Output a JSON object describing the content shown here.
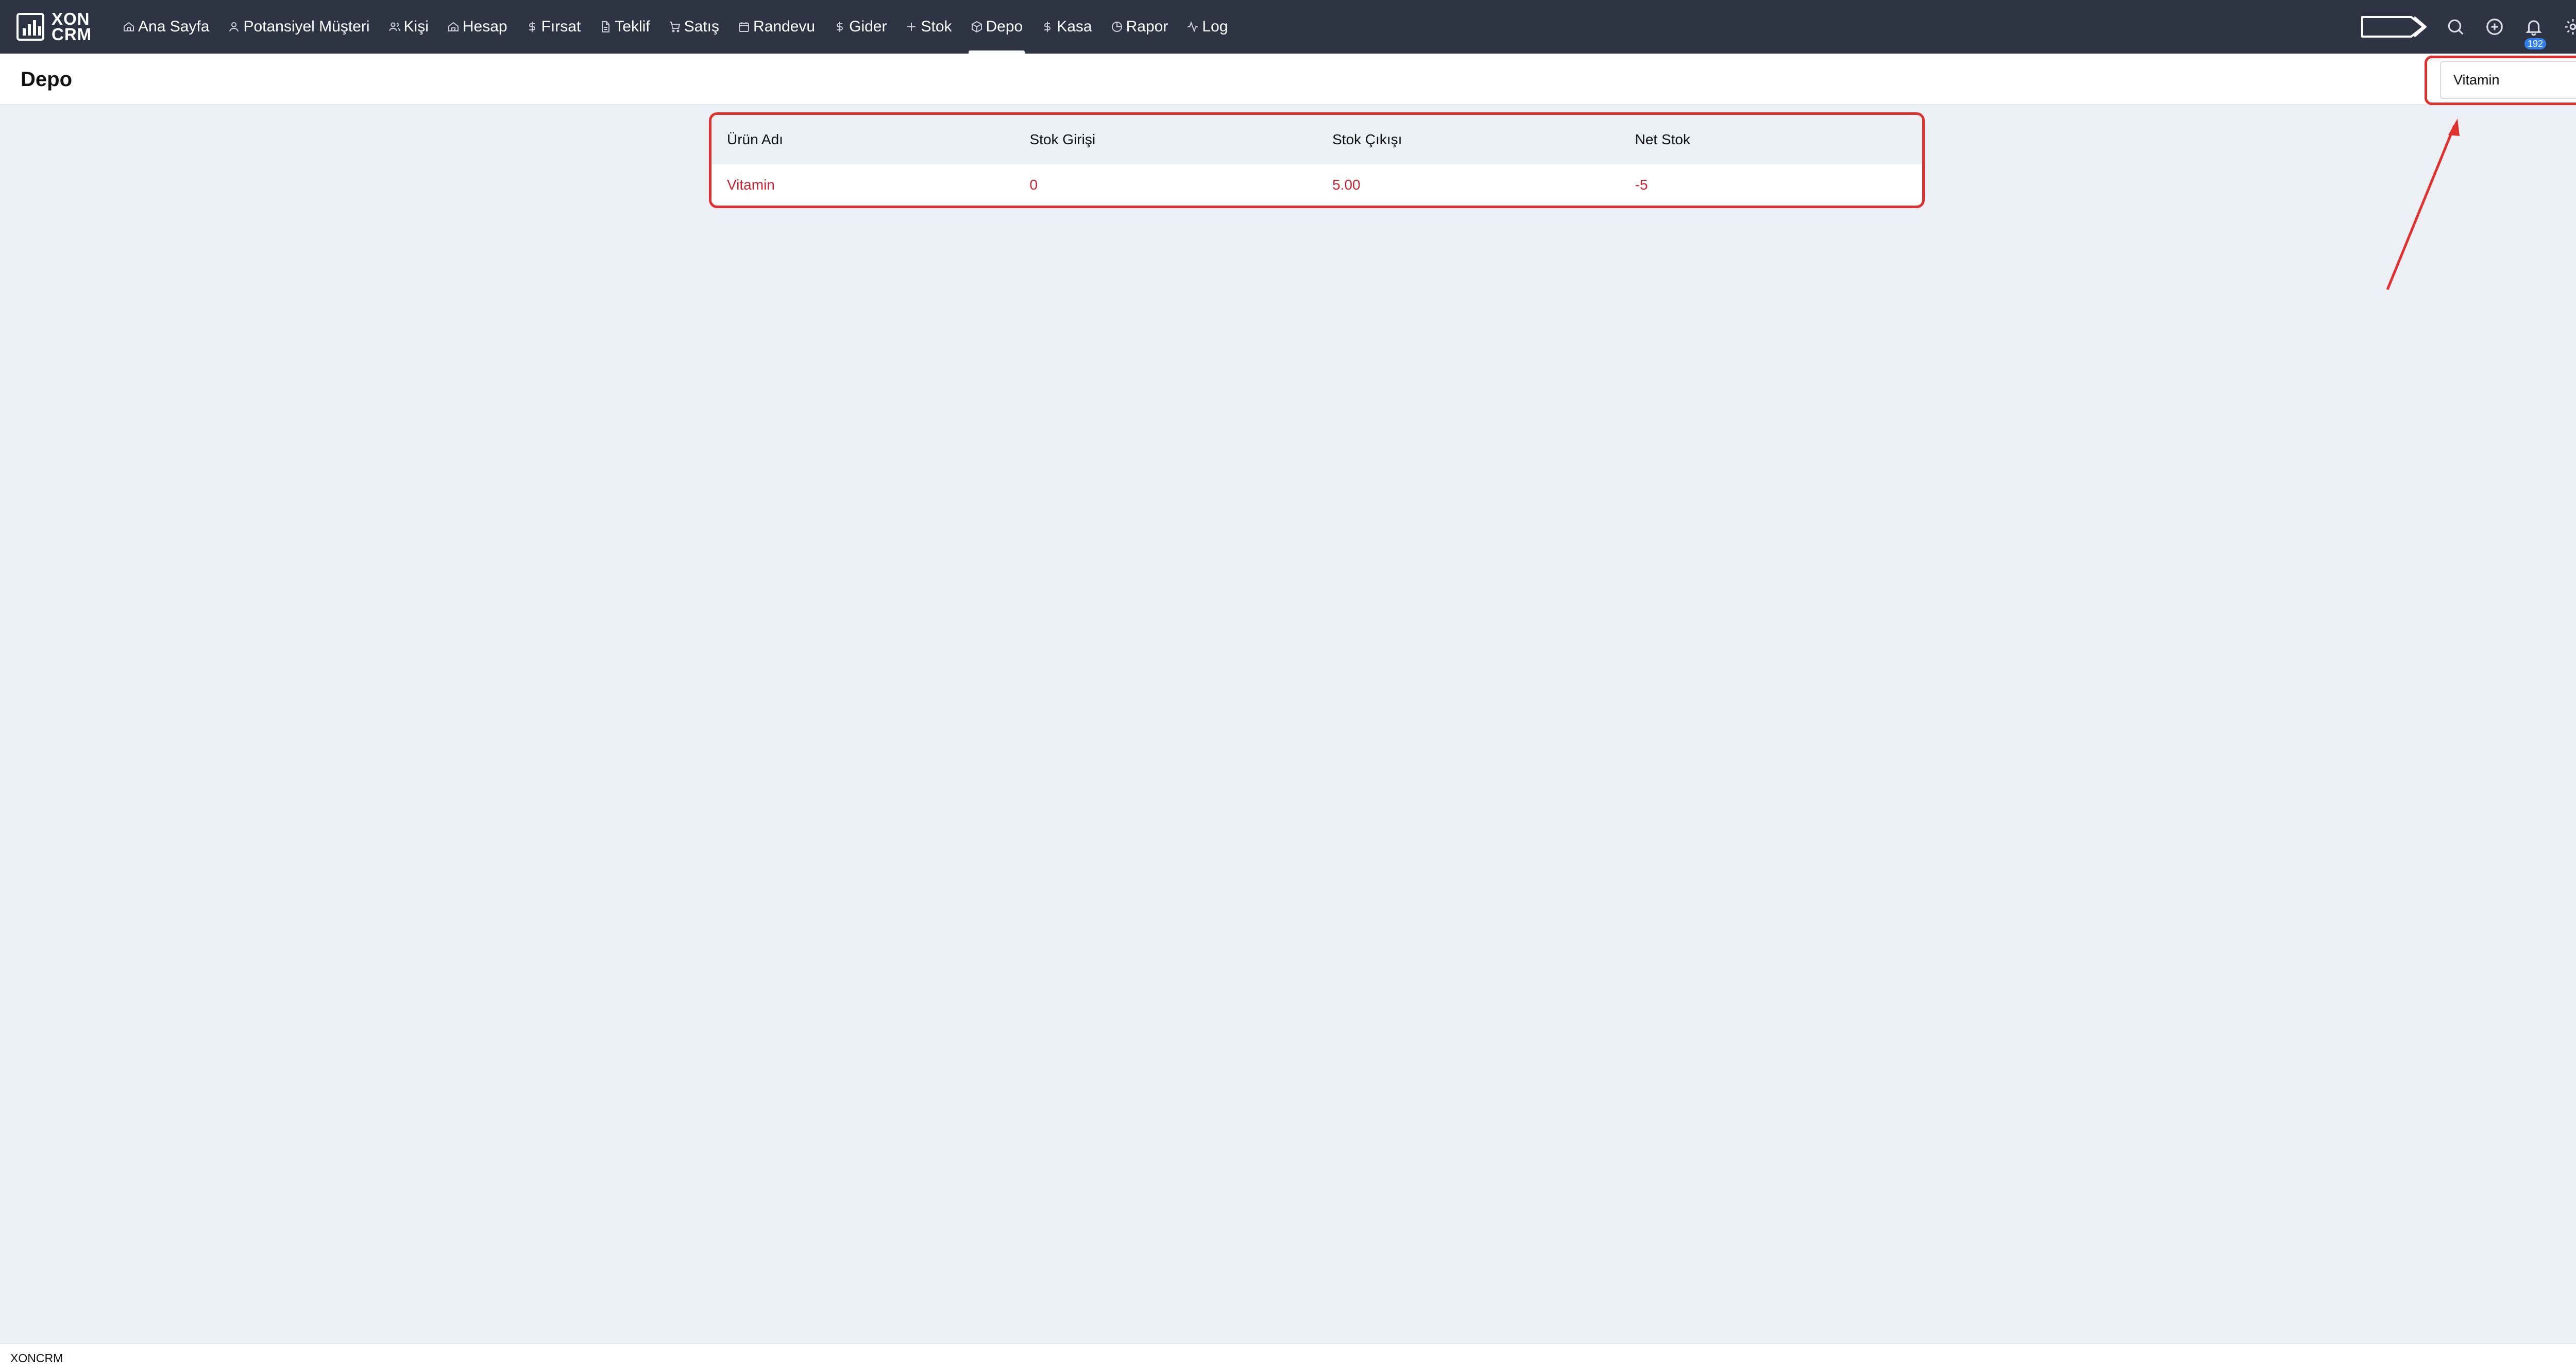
{
  "app": {
    "logo_line1": "XON",
    "logo_line2": "CRM"
  },
  "nav": {
    "items": [
      {
        "label": "Ana Sayfa",
        "icon": "home-icon"
      },
      {
        "label": "Potansiyel Müşteri",
        "icon": "user-icon"
      },
      {
        "label": "Kişi",
        "icon": "users-icon"
      },
      {
        "label": "Hesap",
        "icon": "home-icon"
      },
      {
        "label": "Fırsat",
        "icon": "dollar-icon"
      },
      {
        "label": "Teklif",
        "icon": "document-icon"
      },
      {
        "label": "Satış",
        "icon": "cart-icon"
      },
      {
        "label": "Randevu",
        "icon": "calendar-icon"
      },
      {
        "label": "Gider",
        "icon": "dollar-icon"
      },
      {
        "label": "Stok",
        "icon": "plus-icon"
      },
      {
        "label": "Depo",
        "icon": "box-icon",
        "active": true
      },
      {
        "label": "Kasa",
        "icon": "dollar-icon"
      },
      {
        "label": "Rapor",
        "icon": "pie-chart-icon"
      },
      {
        "label": "Log",
        "icon": "activity-icon"
      }
    ]
  },
  "tools": {
    "notification_count": "192"
  },
  "page": {
    "title": "Depo",
    "search_value": "Vitamin"
  },
  "table": {
    "columns": [
      "Ürün Adı",
      "Stok Girişi",
      "Stok Çıkışı",
      "Net Stok"
    ],
    "rows": [
      [
        "Vitamin",
        "0",
        "5.00",
        "-5"
      ]
    ]
  },
  "footer": {
    "text": "XONCRM"
  },
  "colors": {
    "topbar": "#2e3443",
    "highlight": "#e0312f",
    "row_text": "#cc2233",
    "badge": "#2f80ed"
  }
}
